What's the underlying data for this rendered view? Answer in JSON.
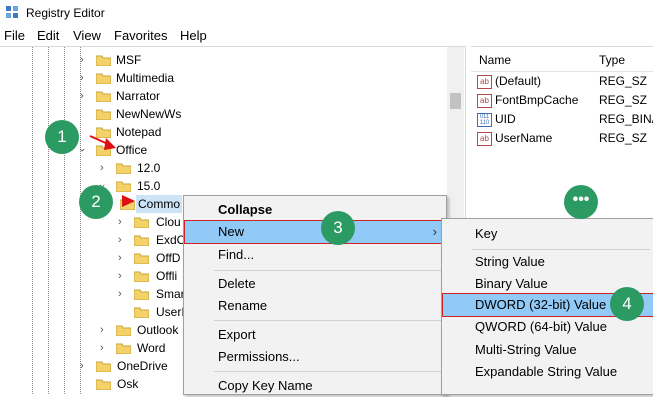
{
  "app": {
    "title": "Registry Editor"
  },
  "menu": [
    "File",
    "Edit",
    "View",
    "Favorites",
    "Help"
  ],
  "tree": {
    "nodes": [
      {
        "label": "MSF"
      },
      {
        "label": "Multimedia"
      },
      {
        "label": "Narrator"
      },
      {
        "label": "NewNewWs"
      },
      {
        "label": "Notepad"
      },
      {
        "label": "Office"
      },
      {
        "label": "12.0"
      },
      {
        "label": "15.0"
      },
      {
        "label": "Commo"
      },
      {
        "label": "Clou"
      },
      {
        "label": "ExdC"
      },
      {
        "label": "OffD"
      },
      {
        "label": "Offli"
      },
      {
        "label": "Smar"
      },
      {
        "label": "UserI"
      },
      {
        "label": "Outlook"
      },
      {
        "label": "Word"
      },
      {
        "label": "OneDrive"
      },
      {
        "label": "Osk"
      }
    ]
  },
  "values_pane": {
    "headers": {
      "name": "Name",
      "type": "Type"
    },
    "rows": [
      {
        "name": "(Default)",
        "type": "REG_SZ",
        "icon": "ab-icon"
      },
      {
        "name": "FontBmpCache",
        "type": "REG_SZ",
        "icon": "ab-icon"
      },
      {
        "name": "UID",
        "type": "REG_BINA",
        "icon": "binary-icon"
      },
      {
        "name": "UserName",
        "type": "REG_SZ",
        "icon": "ab-icon"
      }
    ]
  },
  "context_menu": {
    "collapse": "Collapse",
    "new": "New",
    "find": "Find...",
    "delete": "Delete",
    "rename": "Rename",
    "export": "Export",
    "permissions": "Permissions...",
    "copy_key_name": "Copy Key Name"
  },
  "submenu": {
    "key": "Key",
    "string_value": "String Value",
    "binary_value": "Binary Value",
    "dword_value": "DWORD (32-bit) Value",
    "qword_value": "QWORD (64-bit) Value",
    "multi_string_value": "Multi-String Value",
    "expandable_string_value": "Expandable String Value"
  },
  "annotations": {
    "step1": "1",
    "step2": "2",
    "step3": "3",
    "step4": "4",
    "more": "•••"
  },
  "colors": {
    "accent_green": "#2c9a63",
    "highlight": "#91c9f7",
    "arrow_red": "#dd1111",
    "folder": "#f3d26a"
  }
}
